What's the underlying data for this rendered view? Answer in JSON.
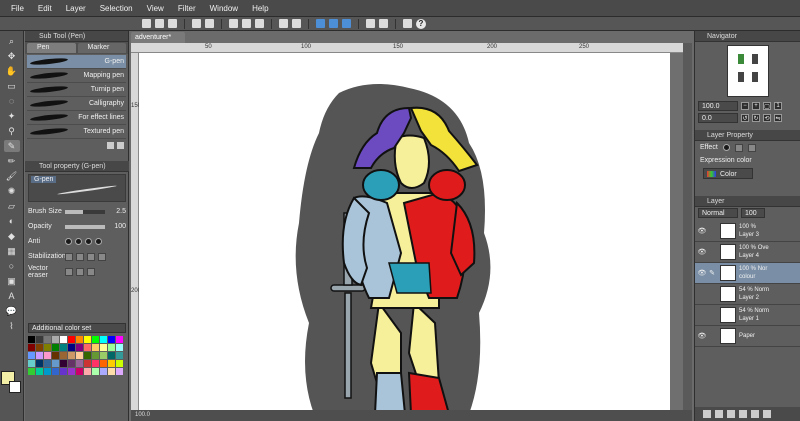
{
  "menu": [
    "File",
    "Edit",
    "Layer",
    "Selection",
    "View",
    "Filter",
    "Window",
    "Help"
  ],
  "sub_tool_panel": {
    "title": "Sub Tool (Pen)",
    "tabs": [
      "Pen",
      "Marker"
    ],
    "brushes": [
      "G-pen",
      "Mapping pen",
      "Turnip pen",
      "Calligraphy",
      "For effect lines",
      "Textured pen"
    ],
    "active_brush": "G-pen"
  },
  "tool_property": {
    "title": "Tool property (G-pen)",
    "preview_name": "G-pen",
    "brush_size_label": "Brush Size",
    "brush_size_value": "2.5",
    "brush_size_level": 0.45,
    "opacity_label": "Opacity",
    "opacity_value": "100",
    "opacity_level": 1.0,
    "anti_alias_label": "Anti",
    "stabilization_label": "Stabilization",
    "vector_label": "Vector eraser"
  },
  "color_set": {
    "selected": "Additional color set",
    "swatches": [
      "#000000",
      "#3a3a3a",
      "#777777",
      "#aaaaaa",
      "#ffffff",
      "#ff0000",
      "#ff8800",
      "#ffff00",
      "#00ff00",
      "#00ffff",
      "#0000ff",
      "#ff00ff",
      "#800000",
      "#804000",
      "#808000",
      "#008000",
      "#008080",
      "#000080",
      "#800080",
      "#ff6666",
      "#ffcc66",
      "#ffff99",
      "#99ff99",
      "#99ffff",
      "#6699ff",
      "#cc99ff",
      "#ff99cc",
      "#663300",
      "#996633",
      "#cc9966",
      "#ffcc99",
      "#336600",
      "#669933",
      "#99cc66",
      "#006666",
      "#339999",
      "#66cccc",
      "#003366",
      "#336699",
      "#6699cc",
      "#330033",
      "#663366",
      "#996699",
      "#cc3333",
      "#ff3366",
      "#ff6600",
      "#ffcc00",
      "#ccff00",
      "#33cc33",
      "#00cc99",
      "#0099cc",
      "#3366cc",
      "#6633cc",
      "#9933cc",
      "#cc0066",
      "#ffaaaa",
      "#aaffaa",
      "#aaaaff",
      "#ffddaa",
      "#ddaaff"
    ]
  },
  "document": {
    "tab_label": "adventurer*"
  },
  "ruler": {
    "top": [
      "50",
      "100",
      "150",
      "200",
      "250"
    ],
    "left": [
      "150",
      "200"
    ]
  },
  "status_text": "100.0",
  "navigator": {
    "title": "Navigator",
    "zoom": "100.0",
    "angle": "0.0"
  },
  "layer_property": {
    "title": "Layer Property",
    "effect_label": "Effect",
    "expression_label": "Expression color",
    "expression_value": "Color"
  },
  "layer_panel": {
    "title": "Layer",
    "blend_mode": "Normal",
    "opacity": "100",
    "layers": [
      {
        "percent": "100 %",
        "mode": "Nor",
        "name": "Layer 3"
      },
      {
        "percent": "100 %",
        "mode": "Ove",
        "name": "Layer 4"
      },
      {
        "percent": "100 %",
        "mode": "Nor",
        "name": "colour"
      },
      {
        "percent": "54 %",
        "mode": "Norm",
        "name": "Layer 2"
      },
      {
        "percent": "54 %",
        "mode": "Norm",
        "name": "Layer 1"
      },
      {
        "percent": "",
        "mode": "",
        "name": "Paper"
      }
    ]
  },
  "colors": {
    "main_color": "#f5f0a8",
    "sub_color": "#ffffff",
    "skin": "#f7f09a",
    "armor": "#a9c4d9",
    "flat_red": "#e01b1b",
    "hair_purple": "#6b4bbf",
    "hair_yellow": "#f3e23a",
    "teal": "#2b9fb8",
    "bg_gray": "#555555"
  }
}
